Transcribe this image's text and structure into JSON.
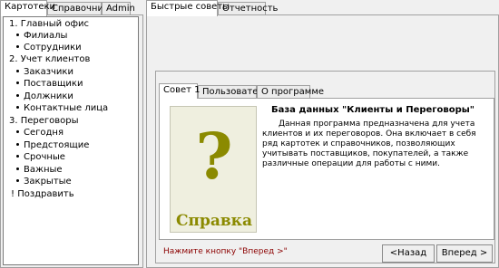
{
  "left_tabs": [
    "Картотеки",
    "Справочники",
    "Admin"
  ],
  "right_tabs": [
    "Быстрые советы",
    "Отчетность"
  ],
  "tree": [
    {
      "label": "1. Главный офис",
      "level": 0
    },
    {
      "label": "Филиалы",
      "level": 1
    },
    {
      "label": "Сотрудники",
      "level": 1
    },
    {
      "label": "2. Учет клиентов",
      "level": 0
    },
    {
      "label": "Заказчики",
      "level": 1
    },
    {
      "label": "Поставщики",
      "level": 1
    },
    {
      "label": "Должники",
      "level": 1
    },
    {
      "label": "Контактные лица",
      "level": 1
    },
    {
      "label": "3. Переговоры",
      "level": 0
    },
    {
      "label": "Сегодня",
      "level": 1
    },
    {
      "label": "Предстоящие",
      "level": 1
    },
    {
      "label": "Срочные",
      "level": 1
    },
    {
      "label": "Важные",
      "level": 1
    },
    {
      "label": "Закрытые",
      "level": 1
    },
    {
      "label": "! Поздравить",
      "level": 0
    }
  ],
  "dialog_tabs": [
    "Совет 1",
    "Пользователи",
    "О программе"
  ],
  "tip": {
    "title": "База данных \"Клиенты и Переговоры\"",
    "text": "Данная программа предназначена для учета клиентов и их переговоров.  Она включает в себя ряд картотек и справочников, позволяющих учитывать поставщиков, покупателей, а также различные операции для работы с ними.",
    "image_symbol": "?",
    "image_label": "Справка"
  },
  "hint": "Нажмите кнопку \"Вперед >\"",
  "buttons": {
    "back": "<Назад",
    "next": "Вперед >"
  },
  "colors": {
    "image_text": "#8b8a00",
    "hint": "#8b0000"
  }
}
